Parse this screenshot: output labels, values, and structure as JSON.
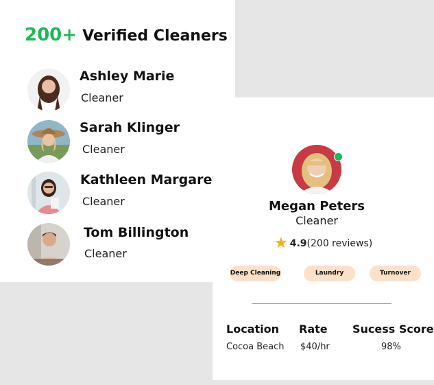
{
  "headline": {
    "count": "200+",
    "title": "Verified Cleaners"
  },
  "cleaners": [
    {
      "name": "Ashley Marie",
      "role": "Cleaner"
    },
    {
      "name": "Sarah Klinger",
      "role": "Cleaner"
    },
    {
      "name": "Kathleen Margaret",
      "role": "Cleaner"
    },
    {
      "name": "Tom Billington",
      "role": "Cleaner"
    }
  ],
  "profile": {
    "name": "Megan Peters",
    "role": "Cleaner",
    "rating": "4.9",
    "reviews": "(200 reviews)",
    "tags": [
      "Deep Cleaning",
      "Laundry",
      "Turnover"
    ],
    "stats": {
      "location_label": "Location",
      "location_value": "Cocoa Beach",
      "rate_label": "Rate",
      "rate_value": "$40/hr",
      "score_label": "Sucess Score",
      "score_value": "98%"
    }
  },
  "colors": {
    "accent": "#1db954",
    "tag_bg": "#fde0c8",
    "star": "#f5b301",
    "background": "#e6e6e6"
  }
}
